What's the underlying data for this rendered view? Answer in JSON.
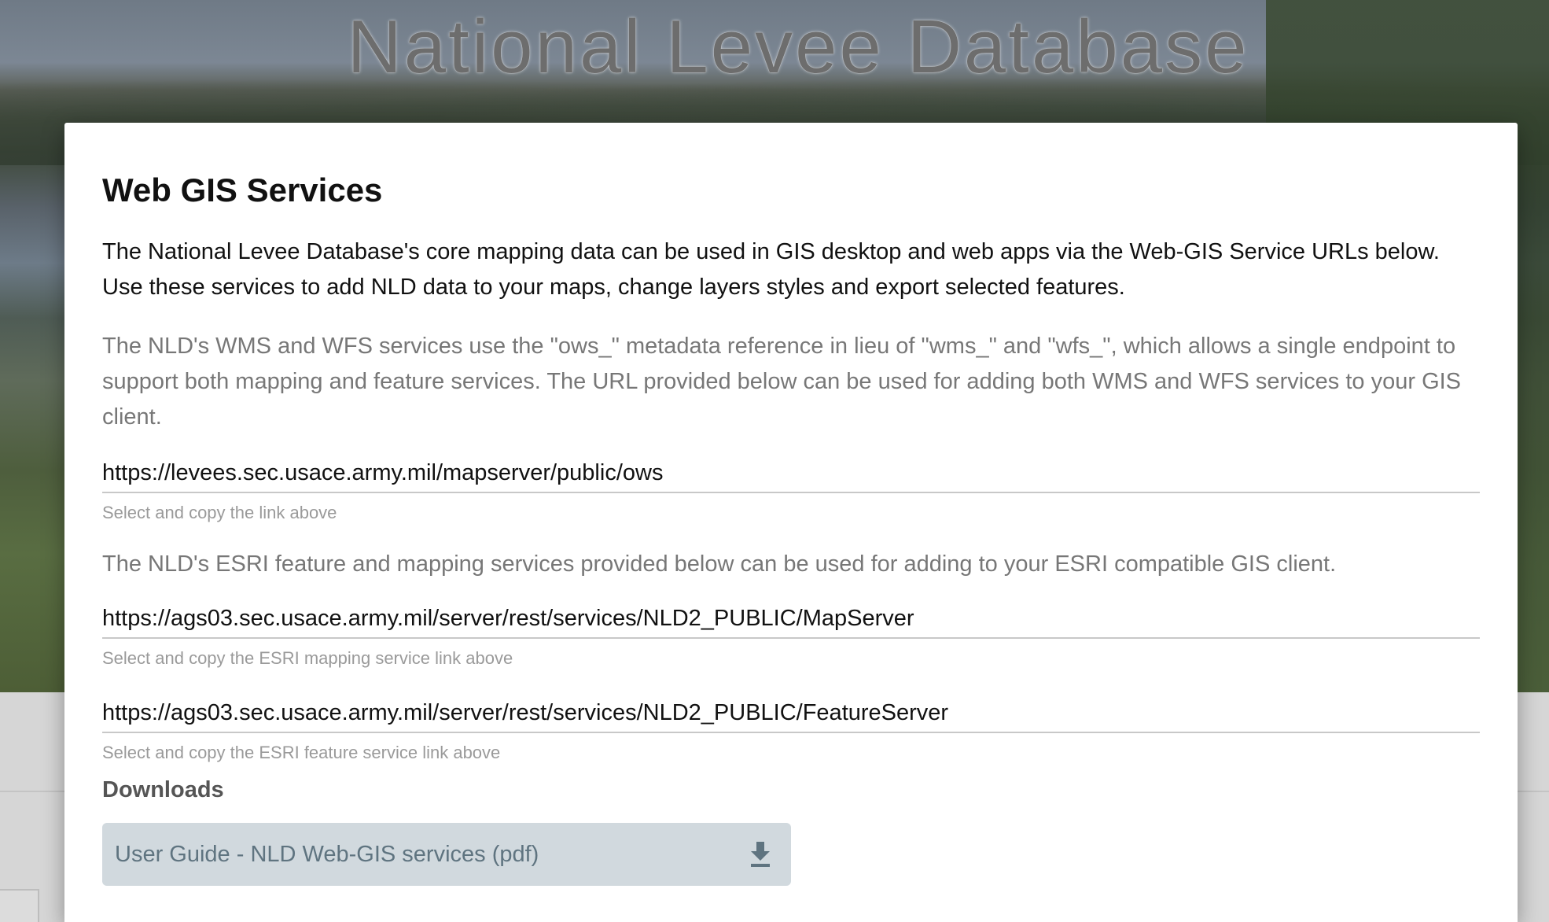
{
  "site": {
    "title": "National Levee Database"
  },
  "dialog": {
    "title": "Web GIS Services",
    "intro": "The National Levee Database's core mapping data can be used in GIS desktop and web apps via the Web-GIS Service URLs below. Use these services to add NLD data to your maps, change layers styles and export selected features.",
    "ows_note": "The NLD's WMS and WFS services use the \"ows_\" metadata reference in lieu of \"wms_\" and \"wfs_\", which allows a single endpoint to support both mapping and feature services. The URL provided below can be used for adding both WMS and WFS services to your GIS client.",
    "ows_url": "https://levees.sec.usace.army.mil/mapserver/public/ows",
    "ows_hint": "Select and copy the link above",
    "esri_note": "The NLD's ESRI feature and mapping services provided below can be used for adding to your ESRI compatible GIS client.",
    "esri_map_url": "https://ags03.sec.usace.army.mil/server/rest/services/NLD2_PUBLIC/MapServer",
    "esri_map_hint": "Select and copy the ESRI mapping service link above",
    "esri_feature_url": "https://ags03.sec.usace.army.mil/server/rest/services/NLD2_PUBLIC/FeatureServer",
    "esri_feature_hint": "Select and copy the ESRI feature service link above",
    "downloads_label": "Downloads",
    "download_button_label": "User Guide - NLD Web-GIS services (pdf)",
    "download_icon": "download-icon"
  },
  "colors": {
    "dialog_background": "#ffffff",
    "download_button_bg": "#d1d9de",
    "download_button_text": "#5f7480",
    "muted_text": "#777777",
    "hint_text": "#9a9a9a"
  }
}
